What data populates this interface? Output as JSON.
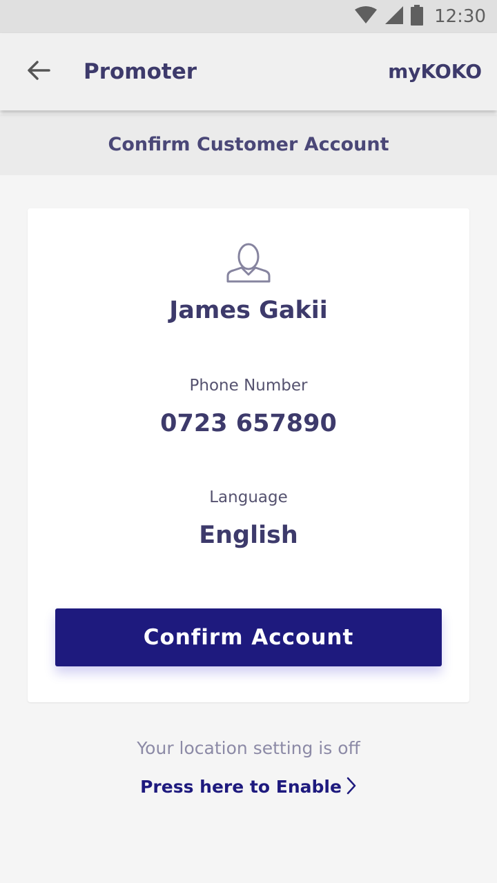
{
  "status_bar": {
    "time": "12:30",
    "icons": [
      "wifi-icon",
      "cell-signal-icon",
      "battery-icon"
    ]
  },
  "app_bar": {
    "back_icon": "arrow-left-icon",
    "title": "Promoter",
    "brand": "myKOKO"
  },
  "subheader": {
    "title": "Confirm Customer Account"
  },
  "card": {
    "avatar_icon": "user-icon",
    "customer_name": "James Gakii",
    "phone_label": "Phone Number",
    "phone_value": "0723 657890",
    "language_label": "Language",
    "language_value": "English",
    "confirm_button": "Confirm Account"
  },
  "location": {
    "message": "Your location setting is off",
    "enable_link": "Press here to Enable",
    "chevron_icon": "chevron-right-icon"
  },
  "colors": {
    "primary": "#1e1a7e",
    "text_dark": "#3d3a6b",
    "text_muted": "#8c8aa6",
    "background": "#f5f5f5"
  }
}
